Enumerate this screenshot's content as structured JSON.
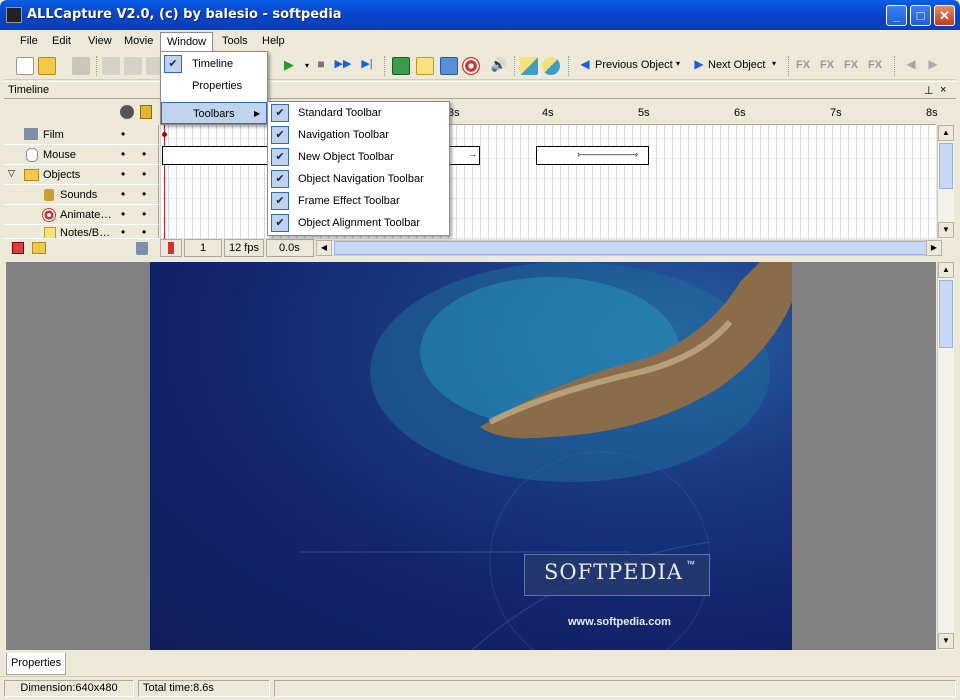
{
  "window": {
    "title": "ALLCapture V2.0, (c) by balesio - softpedia",
    "minimize": "_",
    "maximize": "□",
    "close": "✕"
  },
  "menubar": {
    "items": [
      "File",
      "Edit",
      "View",
      "Movie",
      "Window",
      "Tools",
      "Help"
    ]
  },
  "toolbar": {
    "previous_object": "Previous Object",
    "next_object": "Next Object",
    "fx": "FX"
  },
  "timeline_panel": {
    "title": "Timeline",
    "pin": "⊥",
    "close": "×",
    "ruler_ticks": [
      "3s",
      "4s",
      "5s",
      "6s",
      "7s",
      "8s"
    ],
    "tracks": [
      {
        "label": "Film",
        "icon": "film-icon",
        "dot1": "•",
        "dot2": ""
      },
      {
        "label": "Mouse",
        "icon": "mouse-icon",
        "dot1": "•",
        "dot2": "•"
      },
      {
        "label": "Objects",
        "icon": "folder-icon",
        "dot1": "•",
        "dot2": "•"
      },
      {
        "label": "Sounds",
        "icon": "speaker-icon",
        "dot1": "•",
        "dot2": "•"
      },
      {
        "label": "Animate…",
        "icon": "target-icon",
        "dot1": "•",
        "dot2": "•"
      },
      {
        "label": "Notes/B…",
        "icon": "note-icon",
        "dot1": "•",
        "dot2": "•"
      }
    ],
    "frame": "1",
    "fps": "12 fps",
    "time": "0.0s"
  },
  "window_menu": {
    "items": [
      {
        "label": "Timeline",
        "checked": true
      },
      {
        "label": "Properties",
        "checked": false
      },
      {
        "label": "Toolbars",
        "submenu": true
      }
    ]
  },
  "toolbars_submenu": {
    "items": [
      "Standard Toolbar",
      "Navigation Toolbar",
      "New Object Toolbar",
      "Object Navigation Toolbar",
      "Frame Effect Toolbar",
      "Object Alignment Toolbar"
    ],
    "check": "✔"
  },
  "canvas": {
    "brand": "SOFTPEDIA",
    "tm": "™",
    "url": "www.softpedia.com"
  },
  "properties_tab": "Properties",
  "status": {
    "dimension": "Dimension:640x480",
    "total_time": "Total time:8.6s"
  },
  "colors": {
    "titlebar": "#0a5fe6",
    "menu_highlight": "#316ac5",
    "canvas_bg": "#14256f"
  }
}
